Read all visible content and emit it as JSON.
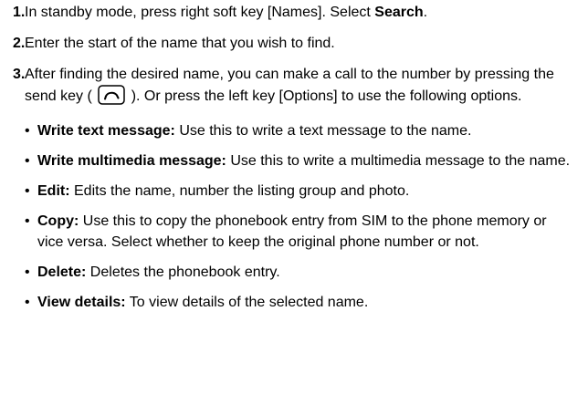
{
  "steps": [
    {
      "num": "1",
      "text_a": "In standby mode, press right soft key [Names]. Select ",
      "bold": "Search",
      "text_b": "."
    },
    {
      "num": "2",
      "text": "Enter the start of the name that you wish to find."
    },
    {
      "num": "3",
      "text_a": "After finding the desired name, you can make a call to the number by pressing the send key ( ",
      "icon": "send-key-icon",
      "text_b": " ). Or press the left key [Options] to use the following options."
    }
  ],
  "options": [
    {
      "term": "Write text message:",
      "desc": " Use this to write a text message to the name."
    },
    {
      "term": "Write multimedia message:",
      "desc": " Use this to write a multimedia message to the name."
    },
    {
      "term": "Edit:",
      "desc": " Edits the name, number the listing group and photo."
    },
    {
      "term": "Copy:",
      "desc": " Use this to copy the phonebook entry from SIM to the phone memory or vice versa. Select whether to keep the original phone number or not."
    },
    {
      "term": "Delete:",
      "desc": " Deletes the phonebook entry."
    },
    {
      "term": "View details:",
      "desc": " To view details of the selected name."
    }
  ]
}
